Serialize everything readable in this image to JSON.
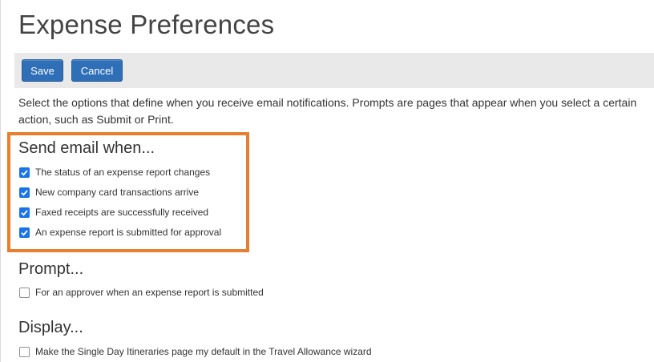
{
  "page": {
    "title": "Expense Preferences"
  },
  "toolbar": {
    "save_label": "Save",
    "cancel_label": "Cancel"
  },
  "intro": {
    "text": "Select the options that define when you receive email notifications. Prompts are pages that appear when you select a certain action, such as Submit or Print."
  },
  "send_email": {
    "heading": "Send email when...",
    "options": [
      {
        "label": "The status of an expense report changes",
        "checked": true
      },
      {
        "label": "New company card transactions arrive",
        "checked": true
      },
      {
        "label": "Faxed receipts are successfully received",
        "checked": true
      },
      {
        "label": "An expense report is submitted for approval",
        "checked": true
      }
    ]
  },
  "prompt": {
    "heading": "Prompt...",
    "options": [
      {
        "label": "For an approver when an expense report is submitted",
        "checked": false
      }
    ]
  },
  "display": {
    "heading": "Display...",
    "options": [
      {
        "label": "Make the Single Day Itineraries page my default in the Travel Allowance wizard",
        "checked": false
      }
    ]
  },
  "colors": {
    "button_blue": "#2f6fb7",
    "checkbox_blue": "#1a73e8",
    "highlight_orange": "#e87e2e",
    "toolbar_gray": "#e9e9e9"
  }
}
